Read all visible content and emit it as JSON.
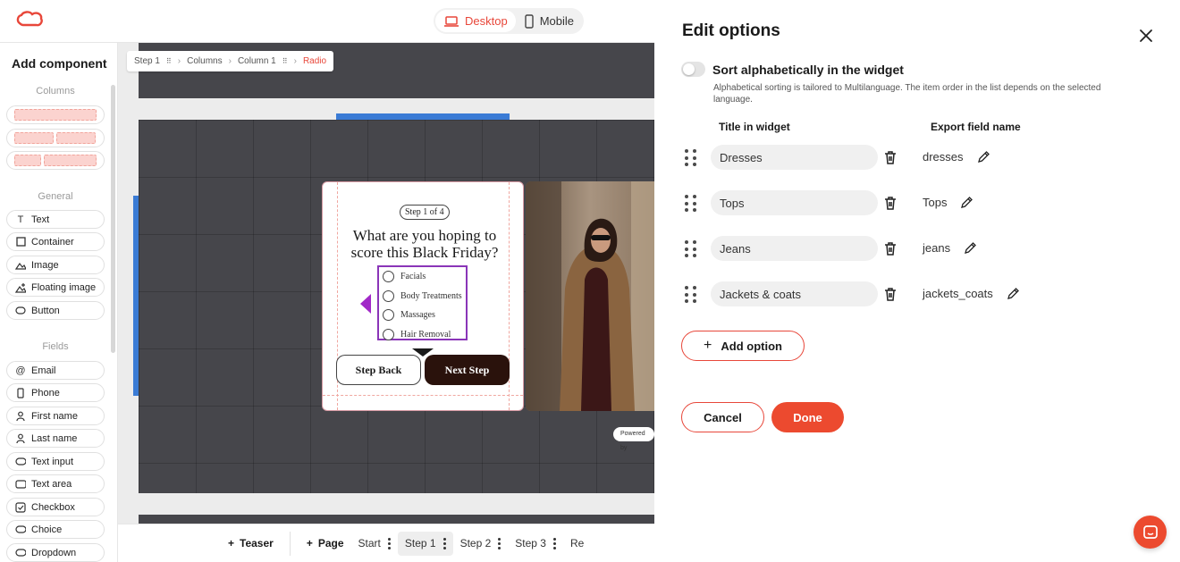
{
  "device_toggle": {
    "desktop_label": "Desktop",
    "mobile_label": "Mobile",
    "active": "desktop"
  },
  "sidebar": {
    "title": "Add component",
    "sections": {
      "columns": "Columns",
      "general": "General",
      "fields": "Fields"
    },
    "general_items": [
      "Text",
      "Container",
      "Image",
      "Floating image",
      "Button"
    ],
    "field_items": [
      "Email",
      "Phone",
      "First name",
      "Last name",
      "Text input",
      "Text area",
      "Checkbox",
      "Choice",
      "Dropdown"
    ]
  },
  "breadcrumb": {
    "items": [
      "Step 1",
      "Columns",
      "Column 1",
      "Radio"
    ]
  },
  "widget": {
    "step_pill": "Step 1 of 4",
    "question": "What are you hoping to score this Black Friday?",
    "options": [
      "Facials",
      "Body Treatments",
      "Massages",
      "Hair Removal"
    ],
    "back_label": "Step Back",
    "next_label": "Next Step",
    "powered_label": "Powered by"
  },
  "stepbar": {
    "teaser": "Teaser",
    "page": "Page",
    "steps": [
      "Start",
      "Step 1",
      "Step 2",
      "Step 3"
    ],
    "active_step": "Step 1",
    "truncated": "Re"
  },
  "panel": {
    "title": "Edit options",
    "sort_label": "Sort alphabetically in the widget",
    "sort_enabled": false,
    "sort_description": "Alphabetical sorting is tailored to Multilanguage. The item order in the list depends on the selected language.",
    "col_title": "Title in widget",
    "col_export": "Export field name",
    "options": [
      {
        "title": "Dresses",
        "export": "dresses"
      },
      {
        "title": "Tops",
        "export": "Tops"
      },
      {
        "title": "Jeans",
        "export": "jeans"
      },
      {
        "title": "Jackets & coats",
        "export": "jackets_coats"
      }
    ],
    "add_label": "Add option",
    "cancel_label": "Cancel",
    "done_label": "Done"
  },
  "colors": {
    "accent": "#ec4a2f",
    "selection": "#3a7bd5",
    "radio_outline": "#8a35b8",
    "next_button": "#2a120c"
  }
}
